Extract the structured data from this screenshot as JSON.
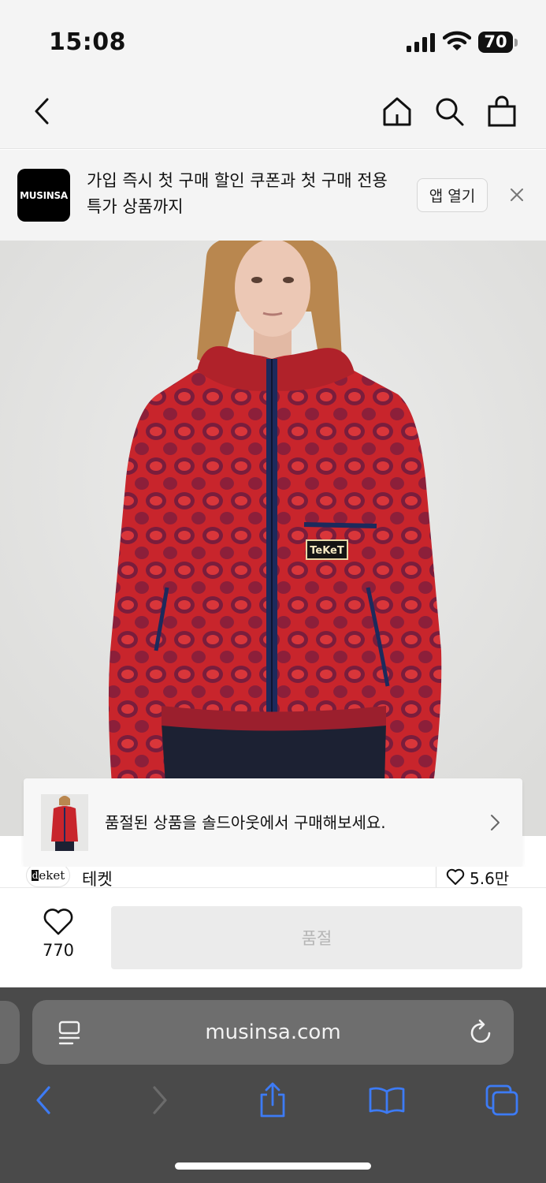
{
  "status": {
    "time": "15:08",
    "battery": "70"
  },
  "nav": {
    "back": "back",
    "home": "home",
    "search": "search",
    "cart": "cart"
  },
  "app_banner": {
    "logo_text": "MUSINSA",
    "message": "가입 즉시 첫 구매 할인 쿠폰과 첫 구매 전용 특가 상품까지",
    "open_label": "앱 열기"
  },
  "toast": {
    "message": "품절된 상품을 솔드아웃에서 구매해보세요."
  },
  "brand": {
    "logo_text": "eket",
    "logo_prefix": "d",
    "name": "테켓",
    "likes": "5.6만"
  },
  "purchase": {
    "like_count": "770",
    "button_label": "품절"
  },
  "browser": {
    "url": "musinsa.com"
  },
  "colors": {
    "accent_blue": "#3d7bf5",
    "jacket_red": "#c0262b",
    "safari_bg": "#4a4a4a"
  },
  "icons": [
    "back-icon",
    "home-icon",
    "search-icon",
    "bag-icon",
    "close-icon",
    "chevron-right-icon",
    "heart-icon",
    "reader-icon",
    "reload-icon",
    "share-icon",
    "bookmarks-icon",
    "tabs-icon"
  ]
}
